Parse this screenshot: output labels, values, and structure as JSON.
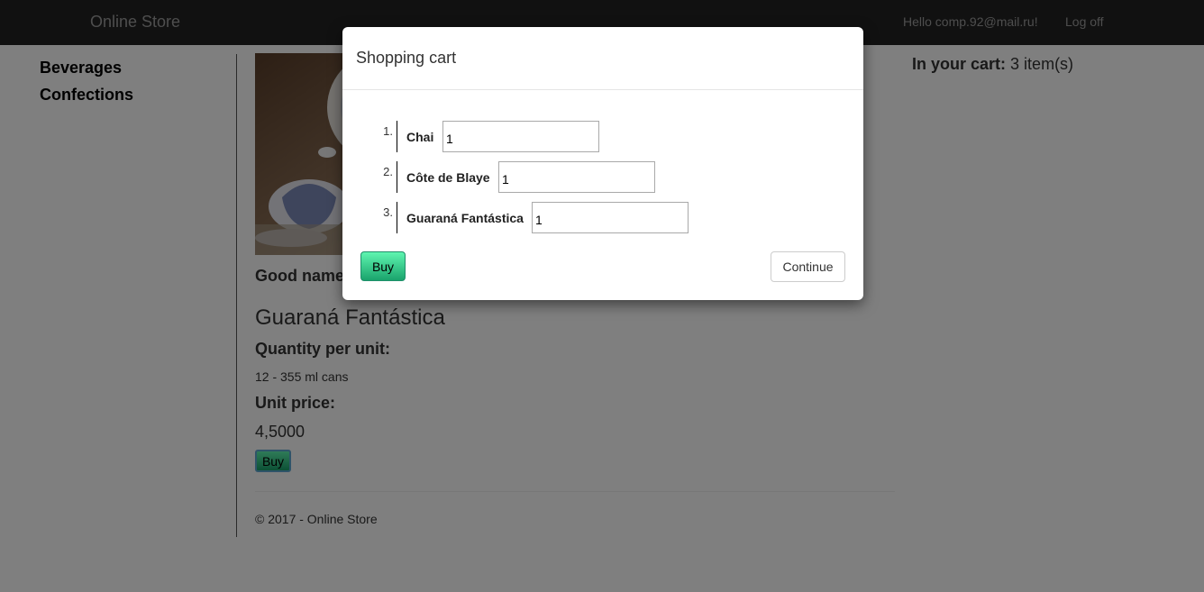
{
  "navbar": {
    "brand": "Online Store",
    "hello": "Hello comp.92@mail.ru!",
    "logoff": "Log off"
  },
  "sidebar": {
    "categories": [
      "Beverages",
      "Confections"
    ]
  },
  "product": {
    "good_name_label": "Good name",
    "name": "Guaraná Fantástica",
    "quantity_label": "Quantity per unit:",
    "quantity_value": "12 - 355 ml cans",
    "price_label": "Unit price:",
    "price_value": "4,5000",
    "buy_label": "Buy"
  },
  "cart_summary": {
    "label": "In your cart:",
    "value": "3 item(s)"
  },
  "footer": {
    "text": "© 2017 - Online Store"
  },
  "modal": {
    "title": "Shopping cart",
    "items": [
      {
        "num": "1.",
        "name": "Chai",
        "qty": "1"
      },
      {
        "num": "2.",
        "name": "Côte de Blaye",
        "qty": "1"
      },
      {
        "num": "3.",
        "name": "Guaraná Fantástica",
        "qty": "1"
      }
    ],
    "buy_label": "Buy",
    "continue_label": "Continue"
  },
  "colors": {
    "navbar_bg": "#222222",
    "buy_gradient_top": "#5ef5b0",
    "buy_gradient_bottom": "#1aa36c"
  }
}
